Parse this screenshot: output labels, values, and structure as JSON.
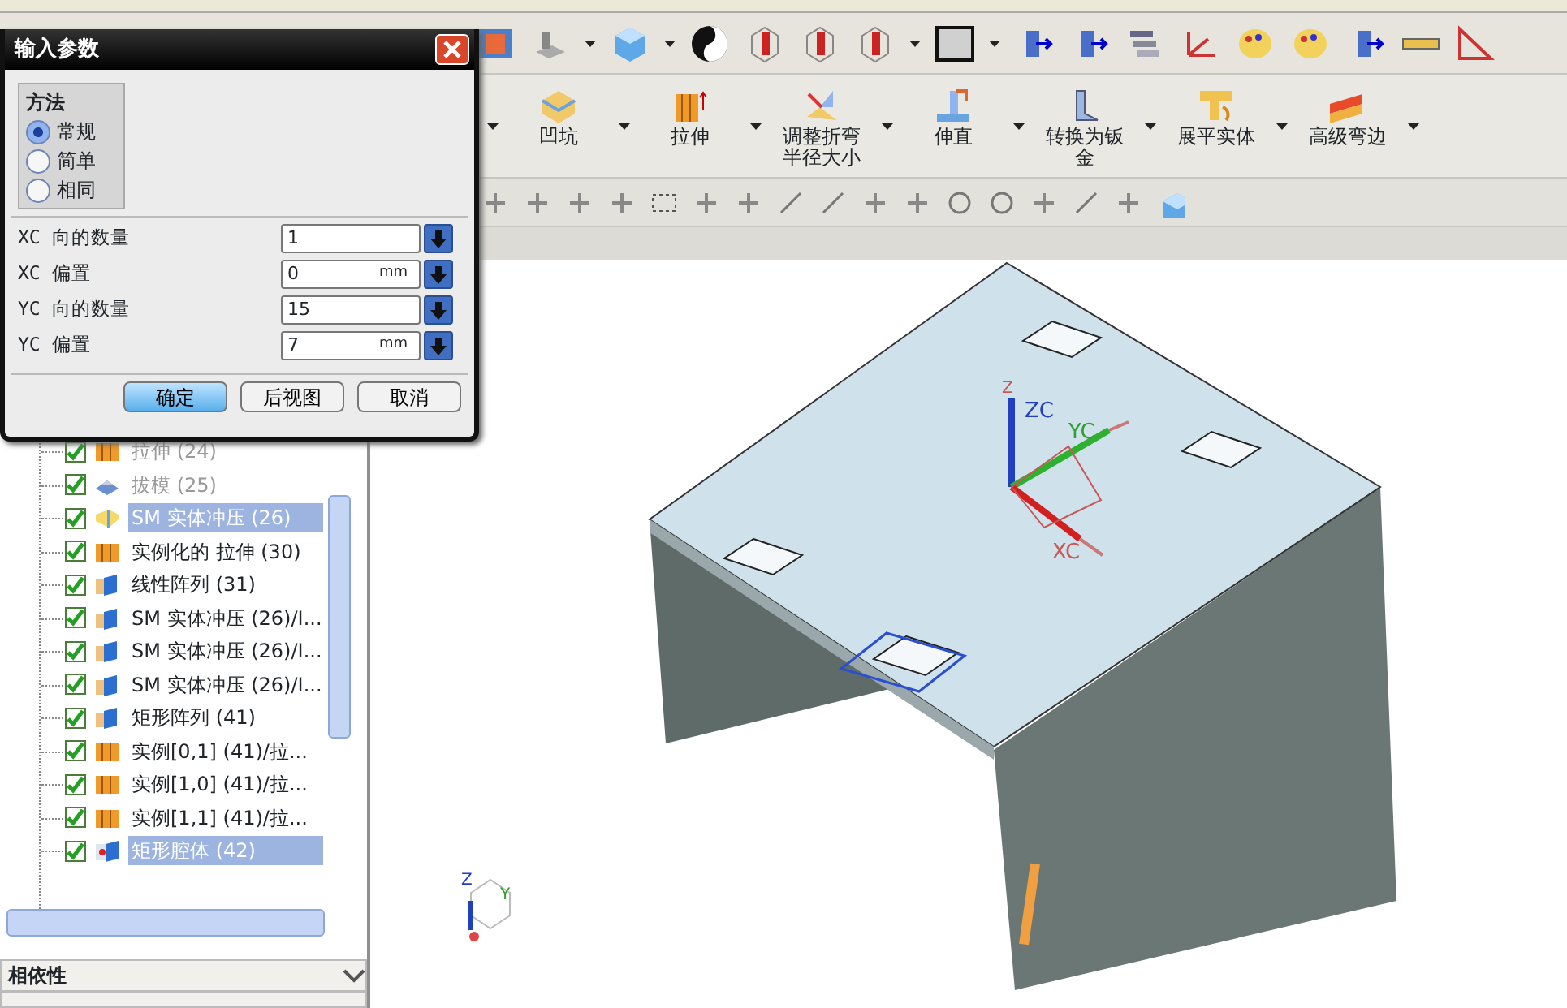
{
  "dialog": {
    "title": "输入参数",
    "method": {
      "title": "方法",
      "options": [
        {
          "label": "常规",
          "selected": true
        },
        {
          "label": "简单",
          "selected": false
        },
        {
          "label": "相同",
          "selected": false
        }
      ]
    },
    "fields": [
      {
        "label": "XC 向的数量",
        "value": "1"
      },
      {
        "label": "XC 偏置",
        "value": "0",
        "unit": "mm"
      },
      {
        "label": "YC 向的数量",
        "value": "15"
      },
      {
        "label": "YC 偏置",
        "value": "7",
        "unit": "mm"
      }
    ],
    "buttons": [
      {
        "label": "确定",
        "default": true
      },
      {
        "label": "后视图",
        "default": false
      },
      {
        "label": "取消",
        "default": false
      }
    ]
  },
  "ribbon": {
    "items": [
      {
        "label": "凹坑",
        "kind": "dimple"
      },
      {
        "label": "拉伸",
        "kind": "extrude"
      },
      {
        "label": "调整折弯半径大小",
        "kind": "bend"
      },
      {
        "label": "伸直",
        "kind": "unbend"
      },
      {
        "label": "转换为钣金",
        "kind": "convert"
      },
      {
        "label": "展平实体",
        "kind": "flatten"
      },
      {
        "label": "高级弯边",
        "kind": "flange"
      }
    ]
  },
  "part_navigator": {
    "items": [
      {
        "label": "拉伸 (24)",
        "kind": "extrude",
        "checked": true,
        "dimmed": true,
        "selected": false
      },
      {
        "label": "拔模 (25)",
        "kind": "draft",
        "checked": true,
        "dimmed": true,
        "selected": false
      },
      {
        "label": "SM 实体冲压 (26)",
        "kind": "stamp",
        "checked": true,
        "dimmed": false,
        "selected": true
      },
      {
        "label": "实例化的 拉伸 (30)",
        "kind": "extrude",
        "checked": true,
        "dimmed": false,
        "selected": false
      },
      {
        "label": "线性阵列 (31)",
        "kind": "pattern",
        "checked": true,
        "dimmed": false,
        "selected": false
      },
      {
        "label": "SM 实体冲压 (26)/I...",
        "kind": "pattern",
        "checked": true,
        "dimmed": false,
        "selected": false
      },
      {
        "label": "SM 实体冲压 (26)/I...",
        "kind": "pattern",
        "checked": true,
        "dimmed": false,
        "selected": false
      },
      {
        "label": "SM 实体冲压 (26)/I...",
        "kind": "pattern",
        "checked": true,
        "dimmed": false,
        "selected": false
      },
      {
        "label": "矩形阵列 (41)",
        "kind": "pattern",
        "checked": true,
        "dimmed": false,
        "selected": false
      },
      {
        "label": "实例[0,1] (41)/拉...",
        "kind": "extrude",
        "checked": true,
        "dimmed": false,
        "selected": false
      },
      {
        "label": "实例[1,0] (41)/拉...",
        "kind": "extrude",
        "checked": true,
        "dimmed": false,
        "selected": false
      },
      {
        "label": "实例[1,1] (41)/拉...",
        "kind": "extrude",
        "checked": true,
        "dimmed": false,
        "selected": false
      },
      {
        "label": "矩形腔体 (42)",
        "kind": "pocket",
        "checked": true,
        "dimmed": false,
        "selected": true
      }
    ]
  },
  "panels": [
    {
      "title": "相依性"
    }
  ],
  "viewport": {
    "csys_labels": [
      {
        "text": "Z",
        "kind": "z"
      },
      {
        "text": "ZC",
        "kind": "zc"
      },
      {
        "text": "YC",
        "kind": "yc"
      },
      {
        "text": "XC",
        "kind": "xc"
      }
    ],
    "triad_labels": [
      {
        "text": "Z",
        "kind": "z"
      },
      {
        "text": "Y",
        "kind": "y"
      }
    ]
  }
}
